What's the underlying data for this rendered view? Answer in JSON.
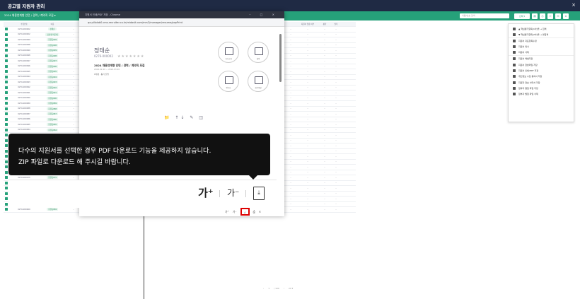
{
  "window": {
    "title": "공고별 지원자 관리",
    "close": "×"
  },
  "toolbar": {
    "filter_label": "2024 채용연계형 인턴 / 경력 / 계약직 모집  ▾",
    "search_placeholder": "이름/번호 검색",
    "selected_label": "선택  ▾"
  },
  "grid": {
    "headers": [
      "",
      "수험번호",
      "이름",
      "",
      "",
      "",
      "",
      "",
      "",
      "",
      "",
      "",
      "",
      "",
      "",
      "",
      "",
      "",
      "지원서 열람 여부",
      "평가",
      "필터"
    ],
    "rows": [
      {
        "no": "0276-000002",
        "name": "정태순"
      },
      {
        "no": "0276-000002",
        "name": "김민재 박은채"
      },
      {
        "no": "0276-000099",
        "name": "홍길동099"
      },
      {
        "no": "0276-000098",
        "name": "홍길동098"
      },
      {
        "no": "0276-000099",
        "name": "홍길동099"
      },
      {
        "no": "0276-000098",
        "name": "홍길동098"
      },
      {
        "no": "0276-000097",
        "name": "홍길동097"
      },
      {
        "no": "0276-000096",
        "name": "홍길동096"
      },
      {
        "no": "0276-000095",
        "name": "홍길동095"
      },
      {
        "no": "0276-000094",
        "name": "홍길동094"
      },
      {
        "no": "0276-000093",
        "name": "홍길동093"
      },
      {
        "no": "0276-000092",
        "name": "홍길동092"
      },
      {
        "no": "0276-000091",
        "name": "홍길동091"
      },
      {
        "no": "0276-000090",
        "name": "홍길동090"
      },
      {
        "no": "0276-000089",
        "name": "홍길동089"
      },
      {
        "no": "0276-000088",
        "name": "홍길동088"
      },
      {
        "no": "0276-000087",
        "name": "홍길동087"
      },
      {
        "no": "0276-000086",
        "name": "홍길동086"
      },
      {
        "no": "0276-000085",
        "name": "홍길동085"
      },
      {
        "no": "0276-000084",
        "name": "홍길동084"
      },
      {
        "no": "0276-000083",
        "name": "홍길동083"
      },
      {
        "no": "0276-000082",
        "name": "홍길동082"
      },
      {
        "no": "0276-000081",
        "name": "홍길동081"
      },
      {
        "no": "0276-000080",
        "name": "홍길동080"
      },
      {
        "no": "0276-000079",
        "name": "홍길동079"
      },
      {
        "no": "0276-000078",
        "name": "홍길동078"
      },
      {
        "no": "0276-000077",
        "name": "홍길동077"
      },
      {
        "no": "0276-000076",
        "name": "홍길동076"
      },
      {
        "no": "0276-000075",
        "name": "홍길동075"
      },
      {
        "no": "0276-000074",
        "name": "홍길동074"
      },
      {
        "no": "0276-000073",
        "name": "홍길동073"
      },
      {
        "no": "0276-000072",
        "name": "홍길동072"
      },
      {
        "no": "0276-000071",
        "name": "홍길동071"
      },
      {
        "no": "0276-000070",
        "name": "홍길동070"
      },
      {
        "no": "0276-000069",
        "name": "홍길동069"
      }
    ],
    "row_extra": {
      "stage": "1차평 / 동기 진행",
      "date": "2024.02.20",
      "status": "정원 ▾",
      "date2": "2024.02.20",
      "result": "확제완료"
    }
  },
  "pager": {
    "prev": "‹",
    "page": "1",
    "of": "/ 100",
    "next": "›",
    "size": "20 ▾"
  },
  "menu": {
    "items": [
      "▲ 핵심평가항목(1차)을 → 합격",
      "▼ 핵심평가항목(2차)을 → 불합격",
      "지원서 지표항목수정",
      "지원서 복사",
      "지원서 삭제",
      "지원서 엑셀저장",
      "지원서 합본파일 저장",
      "지원서 인쇄/PDF 저장",
      "개인정보 수집 동의서 저장",
      "지원자 정보 서약서 저장",
      "첨부자 별첨 파일 저장",
      "첨부자 별첨 파일 삭제"
    ]
  },
  "popup": {
    "title": "지원서 인쇄/PDF 저장 - Chrome",
    "controls": "–  □  ×",
    "url": "qa.pillolab0.cms-recruiter.co.kr/midasit.com/mrs2/manager/resume/popPrint",
    "applicant_name": "정태순",
    "applicant_code": "0276-000002",
    "stars": "★★★★★★★",
    "posting": "2024 채용연계형 인턴 / 경력 / 계약직 모집",
    "date_range": "2024.02.20 ~ 2024.03.20",
    "stage": "1차평 · 동기 진행",
    "thumbs": [
      "자기소개",
      "경력",
      "평가표",
      "첨부파일"
    ],
    "mid_icons": "📁 ↑↓ ✎ ◫",
    "tooltip_line1": "다수의 지원서를 선택한 경우 PDF 다운로드 기능을 제공하지 않습니다.",
    "tooltip_line2": "ZIP 파일로 다운로드 해 주시길 바랍니다.",
    "zoom_in": "가⁺",
    "zoom_out": "가⁻",
    "pdf_icon": "⤓",
    "mini_zoom_in": "가⁺",
    "mini_zoom_out": "가⁻",
    "mini_pdf": "⤓",
    "mini_print": "⎙",
    "mini_close": "✕"
  }
}
